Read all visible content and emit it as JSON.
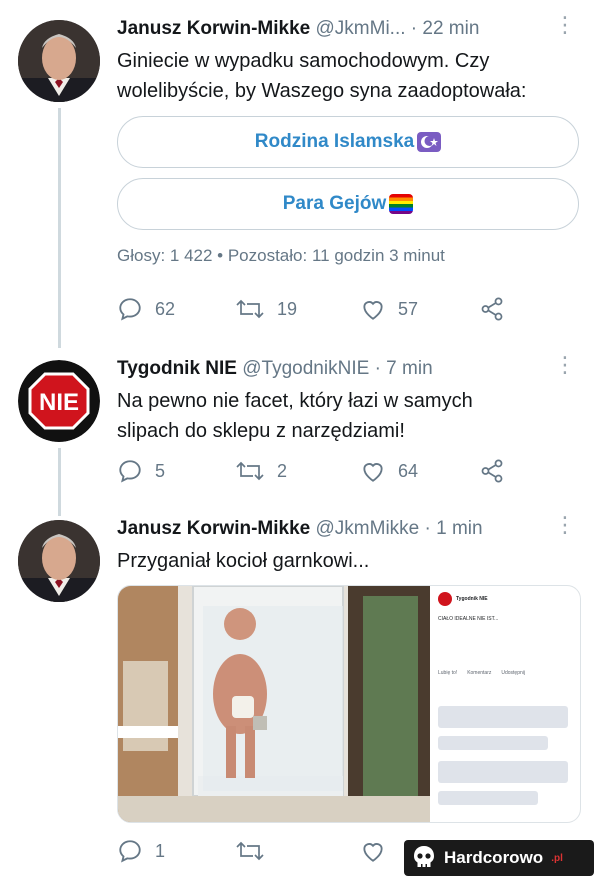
{
  "tweets": [
    {
      "author": "Janusz Korwin-Mikke",
      "handle": "@JkmMi...",
      "time": "22 min",
      "text_lines": [
        "Giniecie w wypadku samochodowym. Czy",
        "wolelibyście, by Waszego syna zaadoptowała:"
      ],
      "poll": {
        "options": [
          "Rodzina Islamska",
          "Para Gejów"
        ],
        "meta": "Głosy: 1 422 • Pozostało: 11 godzin 3 minut"
      },
      "stats": {
        "replies": "62",
        "retweets": "19",
        "likes": "57"
      }
    },
    {
      "author": "Tygodnik NIE",
      "handle": "@TygodnikNIE",
      "time": "7 min",
      "avatar_text": "NIE",
      "text_lines": [
        "Na pewno nie facet, który łazi w samych",
        "slipach do sklepu z narzędziami!"
      ],
      "stats": {
        "replies": "5",
        "retweets": "2",
        "likes": "64"
      }
    },
    {
      "author": "Janusz Korwin-Mikke",
      "handle": "@JkmMikke",
      "time": "1 min",
      "text_lines": [
        "Przyganiał kocioł garnkowi..."
      ],
      "stats": {
        "replies": "1"
      },
      "media": {
        "fb_page": "Tygodnik NIE",
        "fb_caption": "CIAŁO IDEALNE NIE IST...",
        "fb_like": "Lubię to!",
        "fb_comment": "Komentarz",
        "fb_share": "Udostępnij"
      }
    }
  ],
  "watermark": {
    "text": "Hardcorowo",
    "suffix": ".pl"
  },
  "colors": {
    "accent": "#3089c8",
    "muted": "#657786",
    "nie_red": "#d0141d"
  }
}
